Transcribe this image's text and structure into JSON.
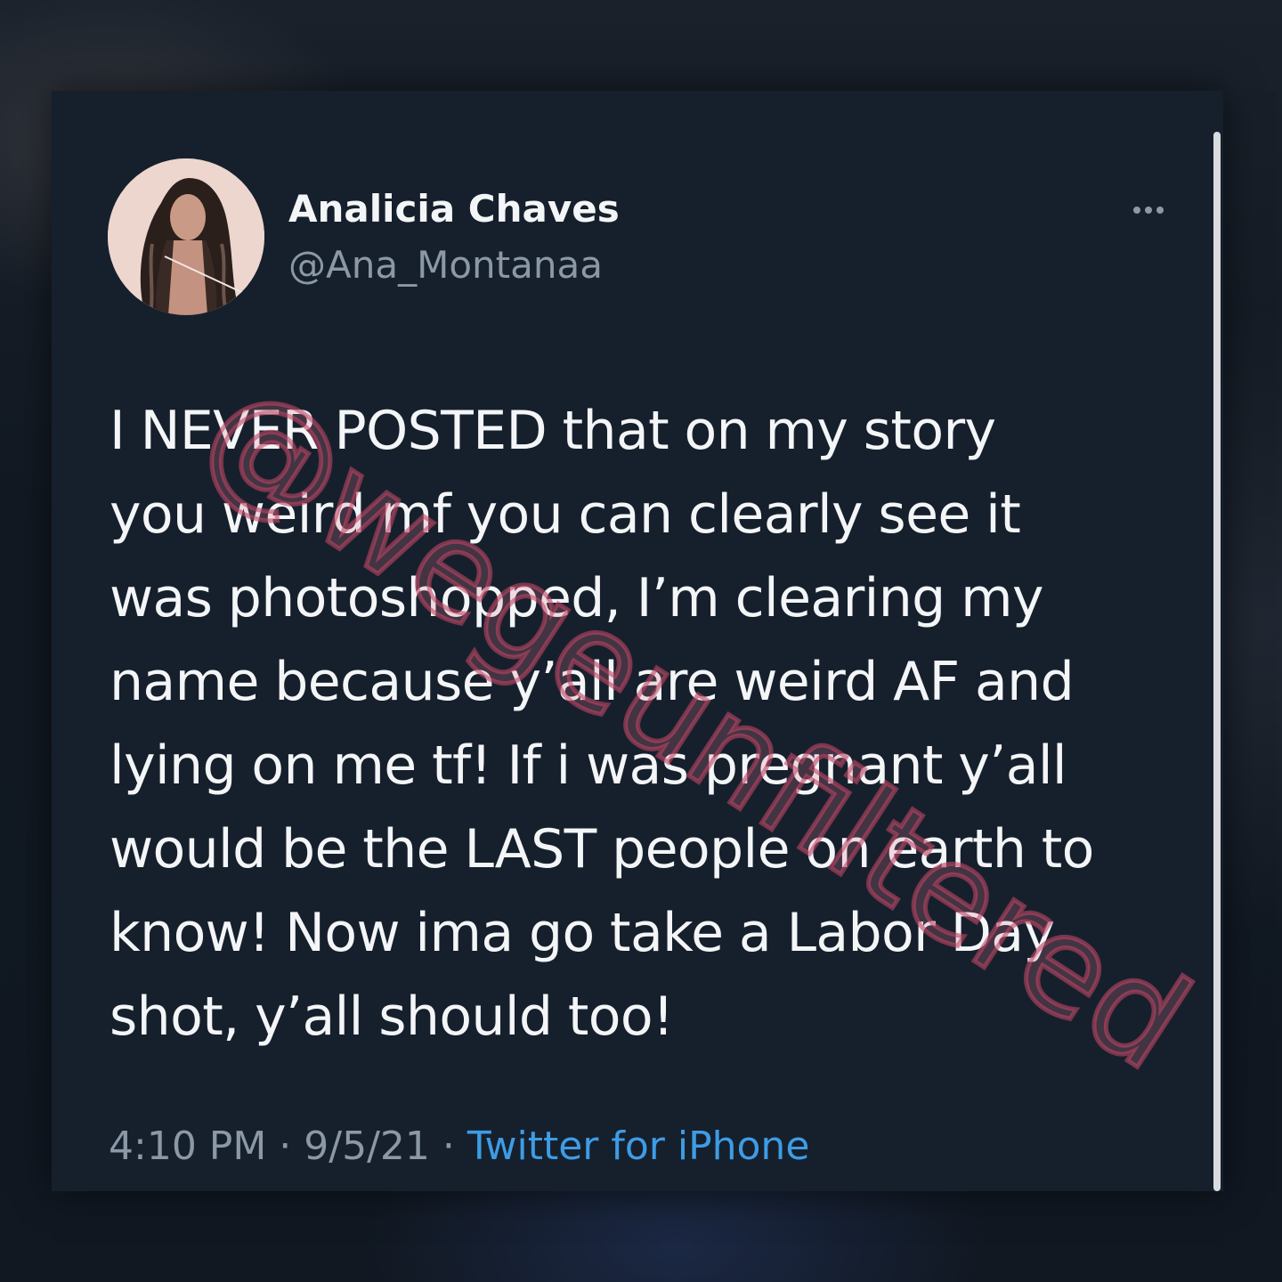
{
  "tweet": {
    "author": {
      "display_name": "Analicia Chaves",
      "handle": "@Ana_Montanaa",
      "avatar_icon": "profile-photo"
    },
    "more_icon": "more-options-icon",
    "text_lines": [
      "I NEVER POSTED that on my story",
      "you weird mf you can clearly see it",
      "was photoshopped, I’m clearing my",
      "name because y’all are weird AF and",
      "lying on me tf! If i was pregnant y’all",
      "would be the LAST people on earth to",
      "know! Now ima go take a Labor Day",
      "shot, y’all should too!"
    ],
    "meta": {
      "time": "4:10 PM",
      "separator": "·",
      "date": "9/5/21",
      "source": "Twitter for iPhone"
    }
  },
  "watermark": "@wegeunfiltered",
  "colors": {
    "card_background": "#16202c",
    "primary_text": "#f3f5f7",
    "secondary_text": "#8b98a5",
    "link": "#3e9ce5",
    "watermark": "#c4466a"
  }
}
